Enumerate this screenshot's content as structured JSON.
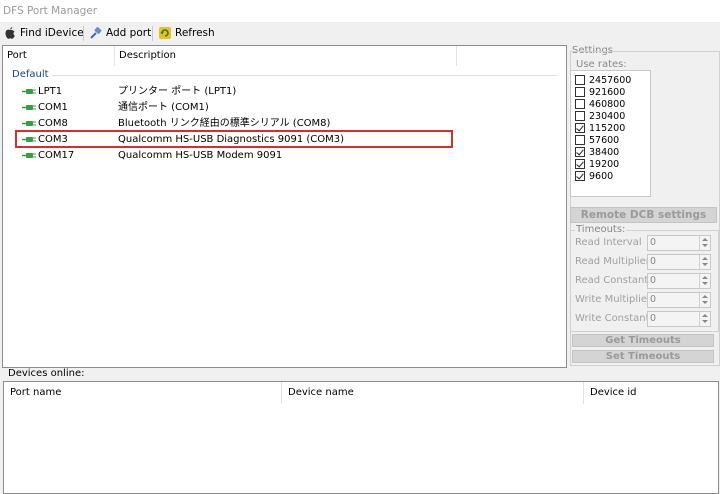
{
  "window": {
    "title": "DFS Port Manager"
  },
  "toolbar": {
    "find": "Find iDevice",
    "add": "Add port",
    "refresh": "Refresh"
  },
  "ports": {
    "col_port": "Port",
    "col_desc": "Description",
    "group": "Default",
    "rows": [
      {
        "name": "LPT1",
        "desc": "プリンター ポート (LPT1)"
      },
      {
        "name": "COM1",
        "desc": "通信ポート (COM1)"
      },
      {
        "name": "COM8",
        "desc": "Bluetooth リンク経由の標準シリアル (COM8)"
      },
      {
        "name": "COM3",
        "desc": "Qualcomm HS-USB Diagnostics 9091 (COM3)"
      },
      {
        "name": "COM17",
        "desc": "Qualcomm HS-USB Modem 9091"
      }
    ]
  },
  "settings": {
    "title": "Settings",
    "use_rates": "Use rates:",
    "rates": [
      {
        "label": "2457600",
        "checked": false
      },
      {
        "label": "921600",
        "checked": false
      },
      {
        "label": "460800",
        "checked": false
      },
      {
        "label": "230400",
        "checked": false
      },
      {
        "label": "115200",
        "checked": true
      },
      {
        "label": "57600",
        "checked": false
      },
      {
        "label": "38400",
        "checked": true
      },
      {
        "label": "19200",
        "checked": true
      },
      {
        "label": "9600",
        "checked": true
      }
    ],
    "remote_dcb": "Remote DCB settings",
    "timeouts_title": "Timeouts:",
    "timeouts": [
      {
        "label": "Read Interval",
        "value": "0"
      },
      {
        "label": "Read Multiplier:",
        "value": "0"
      },
      {
        "label": "Read Constant:",
        "value": "0"
      },
      {
        "label": "Write Multiplier:",
        "value": "0"
      },
      {
        "label": "Write Constant:",
        "value": "0"
      }
    ],
    "get_timeouts": "Get Timeouts",
    "set_timeouts": "Set Timeouts"
  },
  "devices": {
    "label": "Devices online:",
    "col_port": "Port name",
    "col_device": "Device name",
    "col_id": "Device id"
  },
  "colors": {
    "highlight": "#d03030",
    "group_text": "#1e3f8f",
    "port_icon": "#3a9a4a"
  }
}
